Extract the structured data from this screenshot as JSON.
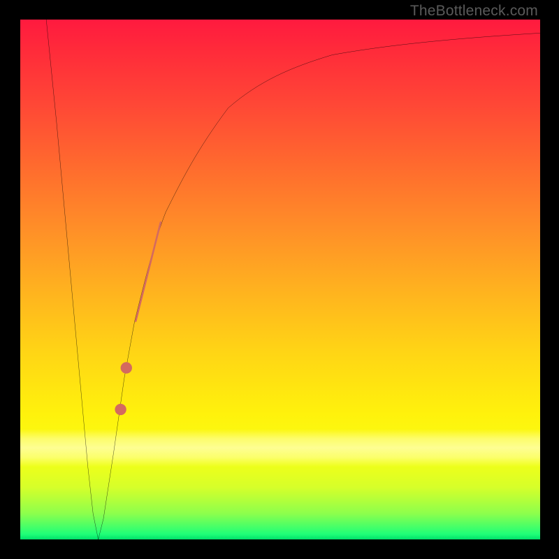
{
  "watermark": "TheBottleneck.com",
  "colors": {
    "frame": "#000000",
    "curve": "#000000",
    "marker": "#d46a5f",
    "gradient_top": "#ff1a3f",
    "gradient_bottom": "#00e06a"
  },
  "chart_data": {
    "type": "line",
    "title": "",
    "xlabel": "",
    "ylabel": "",
    "xlim": [
      0,
      100
    ],
    "ylim": [
      0,
      100
    ],
    "grid": false,
    "legend": false,
    "series": [
      {
        "name": "bottleneck-curve",
        "x": [
          5,
          7,
          9,
          11,
          13,
          14,
          15,
          16,
          18,
          20,
          22,
          25,
          28,
          32,
          36,
          40,
          45,
          50,
          55,
          60,
          66,
          72,
          78,
          84,
          90,
          96,
          100
        ],
        "y": [
          100,
          80,
          58,
          36,
          14,
          5,
          0,
          4,
          17,
          31,
          42,
          54,
          63,
          72,
          78.5,
          83,
          87,
          89.8,
          91.8,
          93.2,
          94.4,
          95.3,
          96.0,
          96.5,
          96.9,
          97.2,
          97.4
        ]
      }
    ],
    "markers": [
      {
        "name": "highlight-segment",
        "x_range": [
          22.2,
          27.0
        ],
        "y_range": [
          42,
          61
        ],
        "style": "thick-line",
        "color": "#d46a5f"
      },
      {
        "name": "highlight-dot-upper",
        "x": 20.4,
        "y": 33,
        "style": "dot",
        "color": "#d46a5f"
      },
      {
        "name": "highlight-dot-lower",
        "x": 19.3,
        "y": 25,
        "style": "dot",
        "color": "#d46a5f"
      }
    ]
  }
}
